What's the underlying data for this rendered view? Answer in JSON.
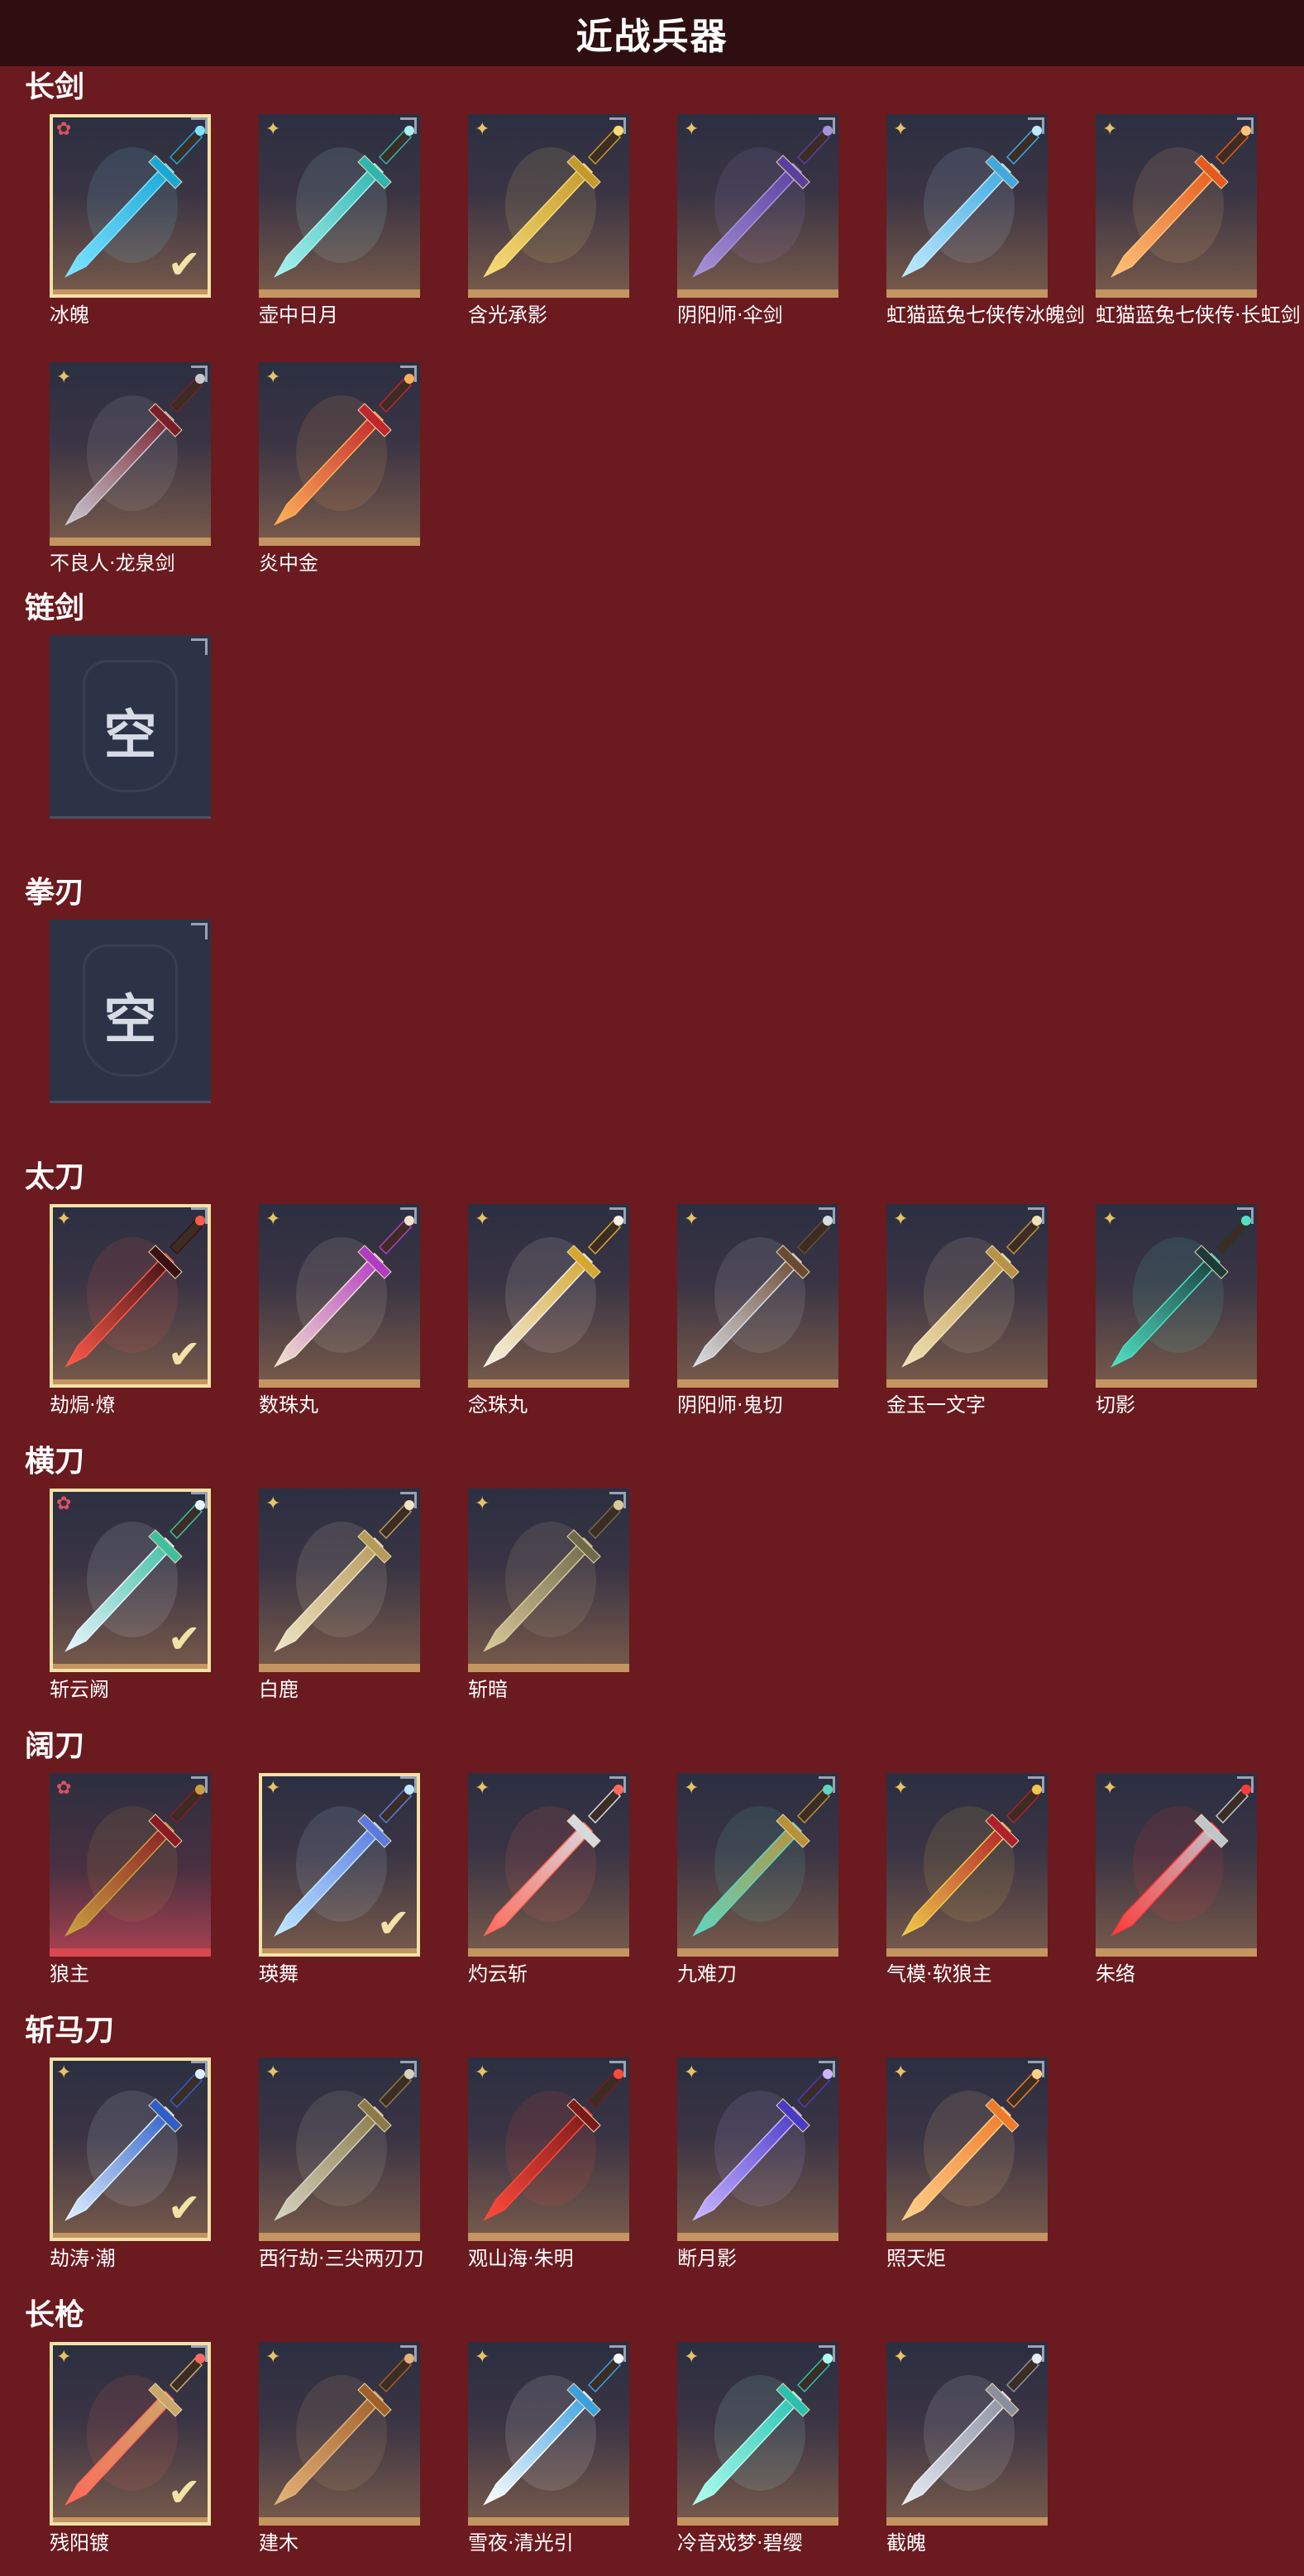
{
  "page": {
    "title": "近战兵器"
  },
  "colors": {
    "background": "#6b1a1f",
    "title_bar": "#2e0e10",
    "tile_bottom_gold": "#c49560",
    "tile_bottom_red": "#d9474f",
    "rank_gold": "#e9c265",
    "rank_red": "#e1505c",
    "selected_outline": "#f3e2a8",
    "empty_tile": "#2c3346"
  },
  "icons": {
    "rank_gold": "✦",
    "rank_red": "✿",
    "check": "✔"
  },
  "sections": [
    {
      "title": "长剑",
      "items": [
        {
          "name": "冰魄",
          "rank": "red",
          "selected": true,
          "colors": [
            "#7fe3ff",
            "#1aa7d8"
          ]
        },
        {
          "name": "壶中日月",
          "rank": "gold",
          "selected": false,
          "colors": [
            "#a9f1ee",
            "#2fb5b0"
          ]
        },
        {
          "name": "含光承影",
          "rank": "gold",
          "selected": false,
          "colors": [
            "#f7dc7a",
            "#c59a2a"
          ]
        },
        {
          "name": "阴阳师·伞剑",
          "rank": "gold",
          "selected": false,
          "colors": [
            "#a793d8",
            "#5b3fa0"
          ]
        },
        {
          "name": "虹猫蓝兔七侠传冰魄剑",
          "rank": "gold",
          "selected": false,
          "colors": [
            "#bfe9ff",
            "#3fa9e0"
          ]
        },
        {
          "name": "虹猫蓝兔七侠传·长虹剑",
          "rank": "gold",
          "selected": false,
          "colors": [
            "#ffc27a",
            "#e55a1c"
          ]
        },
        {
          "name": "不良人·龙泉剑",
          "rank": "gold",
          "selected": false,
          "colors": [
            "#c8c8d0",
            "#7a1e2a"
          ]
        },
        {
          "name": "炎中金",
          "rank": "gold",
          "selected": false,
          "colors": [
            "#ffb05a",
            "#c0262c"
          ]
        }
      ]
    },
    {
      "title": "链剑",
      "items": [
        {
          "name": "",
          "empty": true,
          "empty_text": "空"
        }
      ]
    },
    {
      "title": "拳刃",
      "items": [
        {
          "name": "",
          "empty": true,
          "empty_text": "空"
        }
      ]
    },
    {
      "title": "太刀",
      "items": [
        {
          "name": "劫焗·燎",
          "rank": "gold",
          "selected": true,
          "colors": [
            "#ff5a4a",
            "#3a1014"
          ]
        },
        {
          "name": "数珠丸",
          "rank": "gold",
          "selected": false,
          "colors": [
            "#f2e2cf",
            "#b23bc4"
          ]
        },
        {
          "name": "念珠丸",
          "rank": "gold",
          "selected": false,
          "colors": [
            "#f4f0e6",
            "#d6a730"
          ]
        },
        {
          "name": "阴阳师·鬼切",
          "rank": "gold",
          "selected": false,
          "colors": [
            "#d9dde4",
            "#6b4a33"
          ]
        },
        {
          "name": "金玉一文字",
          "rank": "gold",
          "selected": false,
          "colors": [
            "#f1e2b6",
            "#b89246"
          ]
        },
        {
          "name": "切影",
          "rank": "gold",
          "selected": false,
          "colors": [
            "#4fe0c4",
            "#1c3a3a"
          ]
        }
      ]
    },
    {
      "title": "横刀",
      "items": [
        {
          "name": "斩云阙",
          "rank": "red",
          "selected": true,
          "colors": [
            "#e7f5ff",
            "#3fbfa0"
          ]
        },
        {
          "name": "白鹿",
          "rank": "gold",
          "selected": false,
          "colors": [
            "#efe4c6",
            "#b69a5a"
          ]
        },
        {
          "name": "斩暗",
          "rank": "gold",
          "selected": false,
          "colors": [
            "#d9c99a",
            "#6f6a4a"
          ]
        }
      ]
    },
    {
      "title": "阔刀",
      "items": [
        {
          "name": "狼主",
          "rank": "red",
          "selected": false,
          "red_bottom": true,
          "colors": [
            "#c9a040",
            "#8a1a24"
          ]
        },
        {
          "name": "瑛舞",
          "rank": "gold",
          "selected": true,
          "colors": [
            "#bfe8ff",
            "#5a7ae0"
          ]
        },
        {
          "name": "灼云斩",
          "rank": "gold",
          "selected": false,
          "colors": [
            "#ff6a5a",
            "#d8d8e0"
          ]
        },
        {
          "name": "九难刀",
          "rank": "gold",
          "selected": false,
          "colors": [
            "#5fd6c0",
            "#b8913a"
          ]
        },
        {
          "name": "气模·软狼主",
          "rank": "gold",
          "selected": false,
          "colors": [
            "#f0c84a",
            "#b0202a"
          ]
        },
        {
          "name": "朱络",
          "rank": "gold",
          "selected": false,
          "colors": [
            "#ff3a3a",
            "#c0c4cc"
          ]
        }
      ]
    },
    {
      "title": "斩马刀",
      "items": [
        {
          "name": "劫涛·潮",
          "rank": "gold",
          "selected": true,
          "colors": [
            "#dff0ff",
            "#2f5ec8"
          ]
        },
        {
          "name": "西行劫·三尖两刃刀",
          "rank": "gold",
          "selected": false,
          "colors": [
            "#d6d2c0",
            "#8a7a4a"
          ]
        },
        {
          "name": "观山海·朱明",
          "rank": "gold",
          "selected": false,
          "colors": [
            "#ff4a3a",
            "#7a1a1a"
          ]
        },
        {
          "name": "断月影",
          "rank": "gold",
          "selected": false,
          "colors": [
            "#c8b6ff",
            "#4a3ac8"
          ]
        },
        {
          "name": "照天炬",
          "rank": "gold",
          "selected": false,
          "colors": [
            "#ffd08a",
            "#f07a2a"
          ]
        }
      ]
    },
    {
      "title": "长枪",
      "items": [
        {
          "name": "残阳镀",
          "rank": "gold",
          "selected": true,
          "colors": [
            "#ff6a5a",
            "#c9a86a"
          ]
        },
        {
          "name": "建木",
          "rank": "gold",
          "selected": false,
          "colors": [
            "#e4b27a",
            "#a0602a"
          ]
        },
        {
          "name": "雪夜·清光引",
          "rank": "gold",
          "selected": false,
          "colors": [
            "#ffffff",
            "#3aa0e0"
          ]
        },
        {
          "name": "冷音戏梦·碧缨",
          "rank": "gold",
          "selected": false,
          "colors": [
            "#b0fff0",
            "#2ac0b0"
          ]
        },
        {
          "name": "截魄",
          "rank": "gold",
          "selected": false,
          "colors": [
            "#e8ecf4",
            "#8a8ea0"
          ]
        }
      ]
    }
  ]
}
